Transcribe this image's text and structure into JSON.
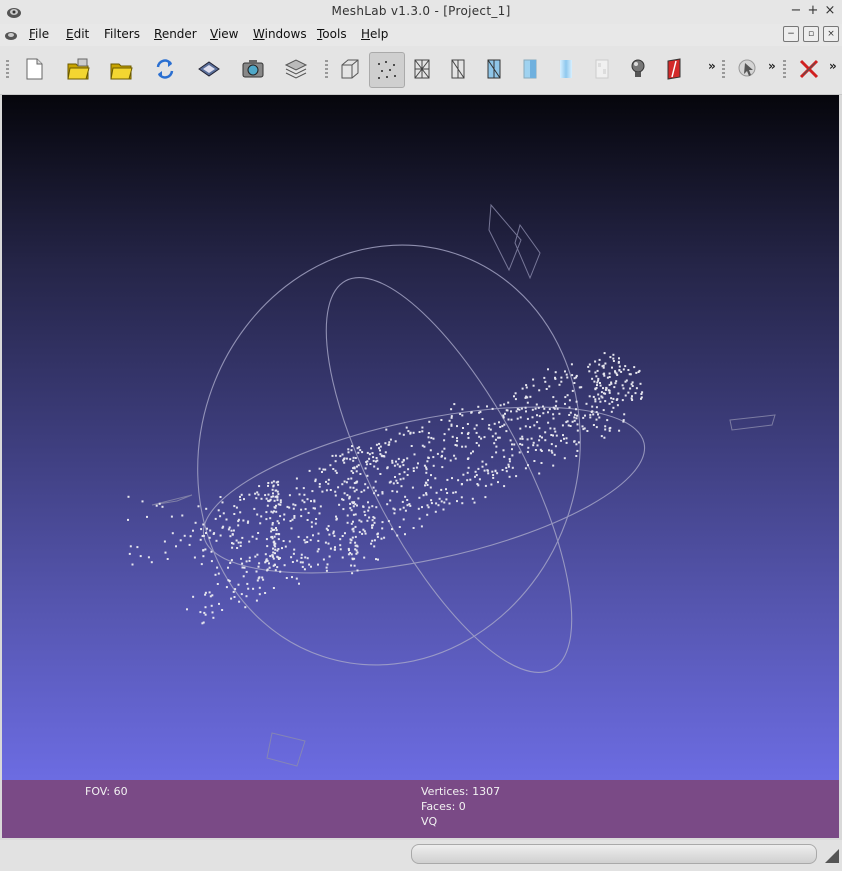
{
  "window": {
    "title": "MeshLab v1.3.0 - [Project_1]"
  },
  "menu": {
    "items": [
      {
        "key": "F",
        "rest": "ile"
      },
      {
        "key": "E",
        "rest": "dit"
      },
      {
        "key": "",
        "rest": "Filters"
      },
      {
        "key": "R",
        "rest": "ender"
      },
      {
        "key": "V",
        "rest": "iew"
      },
      {
        "key": "W",
        "rest": "indows"
      },
      {
        "key": "T",
        "rest": "ools"
      },
      {
        "key": "H",
        "rest": "elp"
      }
    ]
  },
  "toolbar": {
    "buttons": [
      "new-project-icon",
      "open-project-icon",
      "open-mesh-icon",
      "reload-icon",
      "save-icon",
      "snapshot-icon",
      "layers-icon",
      "bounding-box-icon",
      "points-icon",
      "wireframe-icon",
      "hidden-lines-icon",
      "flat-lines-icon",
      "flat-icon",
      "smooth-icon",
      "texture-icon",
      "light-icon",
      "color-mode-icon",
      "select-icon",
      "close-plugin-icon"
    ],
    "active": "points-icon",
    "more": "»"
  },
  "info": {
    "fov": "FOV: 60",
    "vertices": "Vertices: 1307",
    "faces": "Faces: 0",
    "vq": "VQ"
  },
  "status": {
    "progress": 0.0
  }
}
